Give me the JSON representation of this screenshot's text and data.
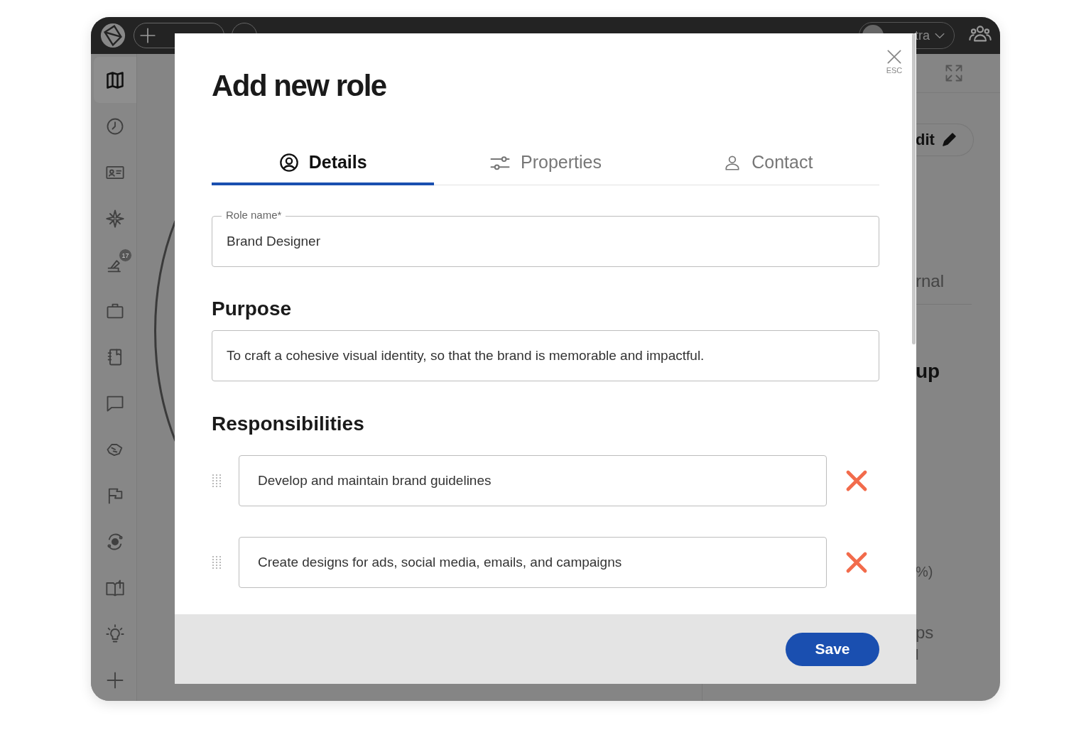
{
  "topbar": {
    "user_name": "tra"
  },
  "sidebar": {
    "items": [
      {
        "selected": true
      },
      {
        "selected": false
      },
      {
        "selected": false
      },
      {
        "selected": false
      },
      {
        "selected": false,
        "badge": "17"
      },
      {
        "selected": false
      },
      {
        "selected": false
      },
      {
        "selected": false
      },
      {
        "selected": false
      },
      {
        "selected": false
      },
      {
        "selected": false
      },
      {
        "selected": false
      },
      {
        "selected": false
      },
      {
        "selected": false
      }
    ]
  },
  "background": {
    "edit_button": "dit",
    "texts": [
      {
        "kind": "label",
        "text": "rnal"
      },
      {
        "kind": "heading",
        "text": "up"
      },
      {
        "kind": "small",
        "text": "%)"
      },
      {
        "kind": "label",
        "text": "ps"
      },
      {
        "kind": "small",
        "text": "l"
      }
    ]
  },
  "dialog": {
    "title": "Add new role",
    "close_hint": "ESC",
    "tabs": [
      {
        "label": "Details",
        "selected": true
      },
      {
        "label": "Properties",
        "selected": false
      },
      {
        "label": "Contact",
        "selected": false
      }
    ],
    "role_field": {
      "label": "Role name*",
      "value": "Brand Designer"
    },
    "purpose": {
      "heading": "Purpose",
      "value": "To craft a cohesive visual identity, so that the brand is memorable and impactful."
    },
    "responsibilities": {
      "heading": "Responsibilities",
      "items": [
        "Develop and maintain brand guidelines",
        "Create designs for ads, social media, emails, and campaigns"
      ]
    },
    "save_button": "Save"
  }
}
